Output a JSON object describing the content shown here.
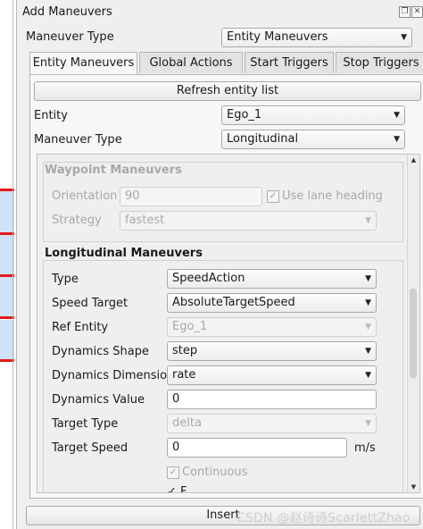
{
  "dock": {
    "title": "Add Maneuvers",
    "float_icon": "float-icon",
    "close_icon": "close-icon"
  },
  "top": {
    "maneuver_type_label": "Maneuver Type",
    "maneuver_type_value": "Entity Maneuvers"
  },
  "tabs": [
    {
      "label": "Entity Maneuvers",
      "active": true
    },
    {
      "label": "Global Actions",
      "active": false
    },
    {
      "label": "Start Triggers",
      "active": false
    },
    {
      "label": "Stop Triggers",
      "active": false
    }
  ],
  "entity_tab": {
    "refresh_label": "Refresh entity list",
    "entity_label": "Entity",
    "entity_value": "Ego_1",
    "maneuver_type_label": "Maneuver Type",
    "maneuver_type_value": "Longitudinal"
  },
  "waypoint": {
    "title": "Waypoint Maneuvers",
    "orientation_label": "Orientation",
    "orientation_value": "90",
    "use_lane_heading_label": "Use lane heading",
    "use_lane_heading_checked": true,
    "strategy_label": "Strategy",
    "strategy_value": "fastest"
  },
  "longitudinal": {
    "title": "Longitudinal Maneuvers",
    "type_label": "Type",
    "type_value": "SpeedAction",
    "speed_target_label": "Speed Target",
    "speed_target_value": "AbsoluteTargetSpeed",
    "ref_entity_label": "Ref Entity",
    "ref_entity_value": "Ego_1",
    "dynamics_shape_label": "Dynamics Shape",
    "dynamics_shape_value": "step",
    "dynamics_dimension_label": "Dynamics Dimension",
    "dynamics_dimension_value": "rate",
    "dynamics_value_label": "Dynamics Value",
    "dynamics_value_value": "0",
    "target_type_label": "Target Type",
    "target_type_value": "delta",
    "target_speed_label": "Target Speed",
    "target_speed_value": "0",
    "target_speed_unit": "m/s",
    "continuous_label": "Continuous",
    "continuous_checked": true,
    "partial_label": "✓ F"
  },
  "footer": {
    "insert_label": "Insert",
    "watermark": "CSDN @赵诗诗ScarlettZhao"
  },
  "colors": {
    "accent_red": "#e21b1b",
    "strip_blue": "#cfe2f6",
    "panel_bg": "#efefef"
  }
}
